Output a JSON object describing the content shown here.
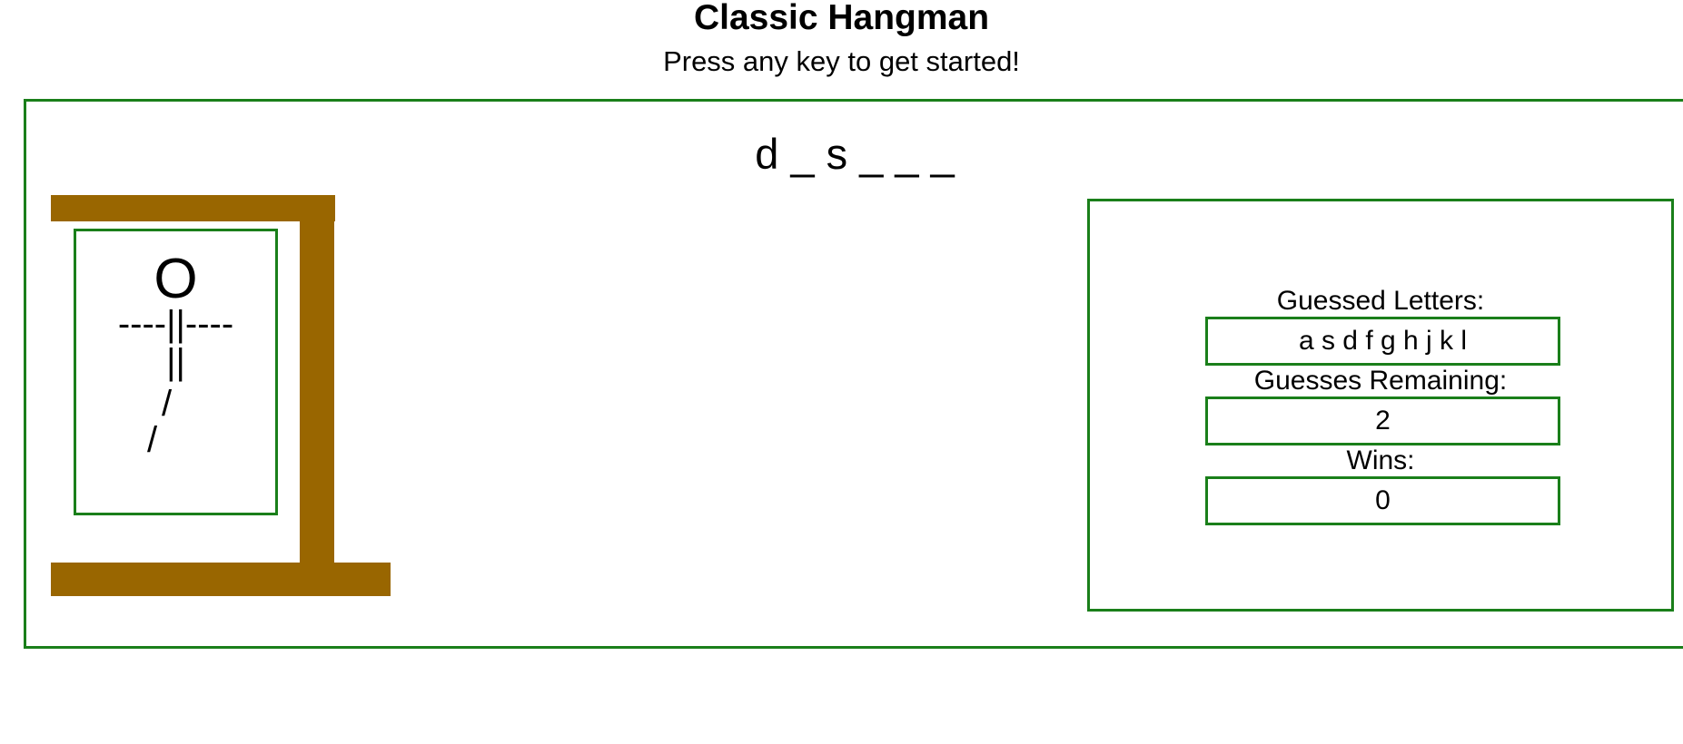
{
  "header": {
    "title": "Classic Hangman",
    "subtitle": "Press any key to get started!"
  },
  "game": {
    "word_display": "d _ s _ _ _",
    "figure": {
      "head": "O",
      "arms": "----||----",
      "body": "||",
      "leg_upper": "/",
      "leg_lower": "/"
    }
  },
  "stats": {
    "guessed_label": "Guessed Letters:",
    "guessed_value": "a s d f g h j k l",
    "remaining_label": "Guesses Remaining:",
    "remaining_value": "2",
    "wins_label": "Wins:",
    "wins_value": "0"
  },
  "colors": {
    "accent_border": "#1a7f1a",
    "gallows": "#996600"
  }
}
